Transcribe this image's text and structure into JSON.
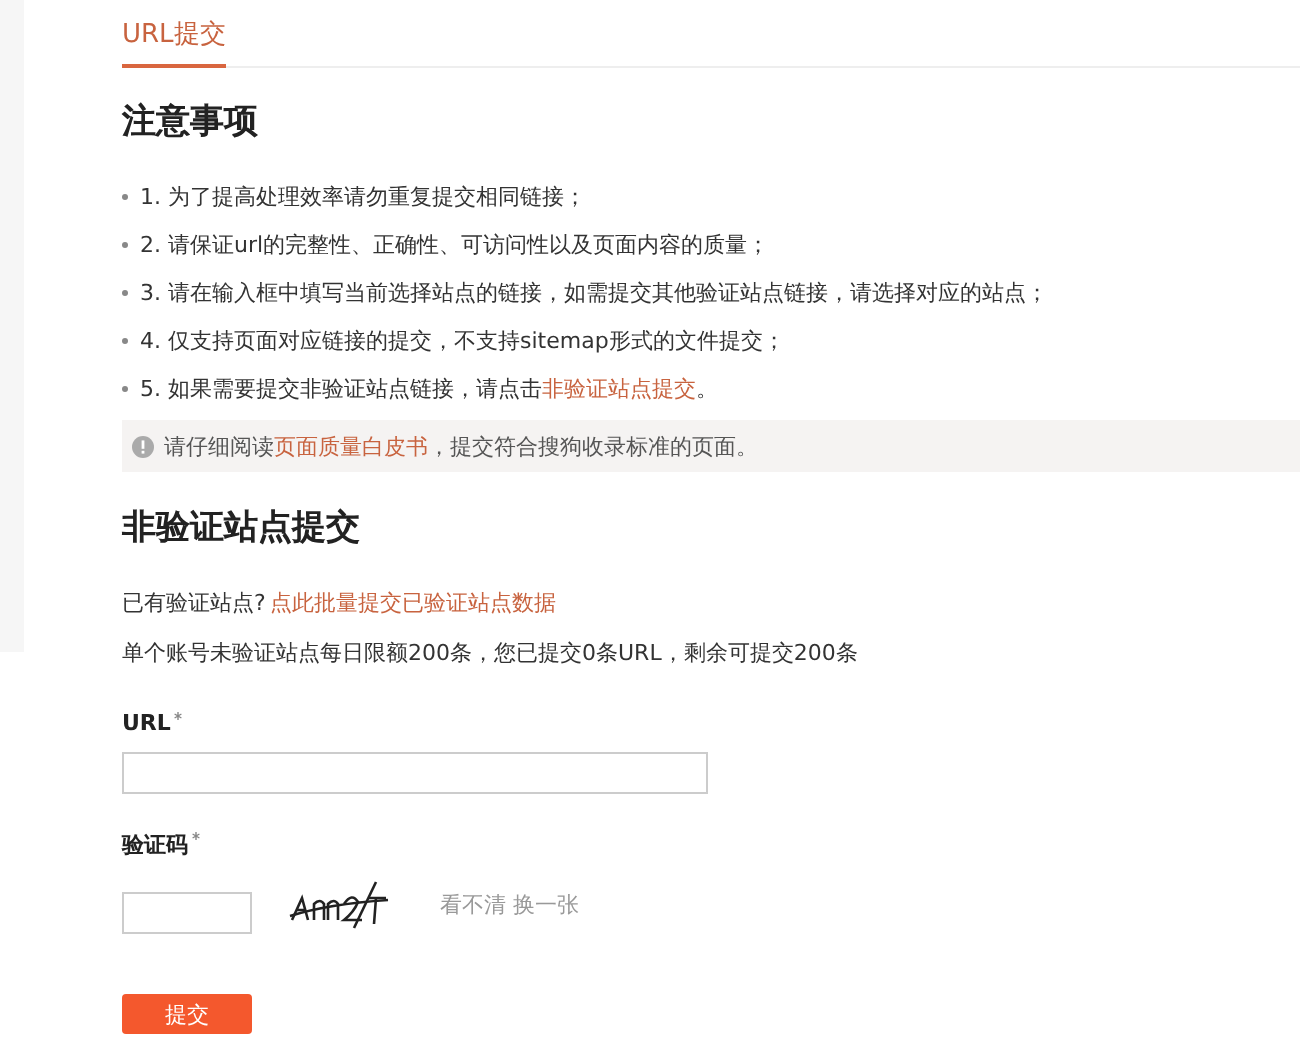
{
  "tabs": [
    {
      "label": "URL提交",
      "selected": true
    }
  ],
  "notes": {
    "title": "注意事项",
    "items": [
      {
        "text": "1. 为了提高处理效率请勿重复提交相同链接；"
      },
      {
        "text": "2. 请保证url的完整性、正确性、可访问性以及页面内容的质量；"
      },
      {
        "text": "3. 请在输入框中填写当前选择站点的链接，如需提交其他验证站点链接，请选择对应的站点；"
      },
      {
        "text": "4. 仅支持页面对应链接的提交，不支持sitemap形式的文件提交；"
      },
      {
        "text": "5. 如果需要提交非验证站点链接，请点击",
        "link": "非验证站点提交",
        "after": "。"
      }
    ],
    "notice": {
      "before": "请仔细阅读",
      "link": "页面质量白皮书",
      "after": "，提交符合搜狗收录标准的页面。"
    }
  },
  "form": {
    "title": "非验证站点提交",
    "verified_prompt": "已有验证站点?",
    "verified_link": "点此批量提交已验证站点数据",
    "quota": "单个账号未验证站点每日限额200条，您已提交0条URL，剩余可提交200条",
    "fields": [
      {
        "kind": "url",
        "label": "URL",
        "required": true
      },
      {
        "kind": "captcha",
        "label": "验证码",
        "required": true,
        "refresh": "看不清 换一张"
      }
    ],
    "submit": "提交"
  }
}
